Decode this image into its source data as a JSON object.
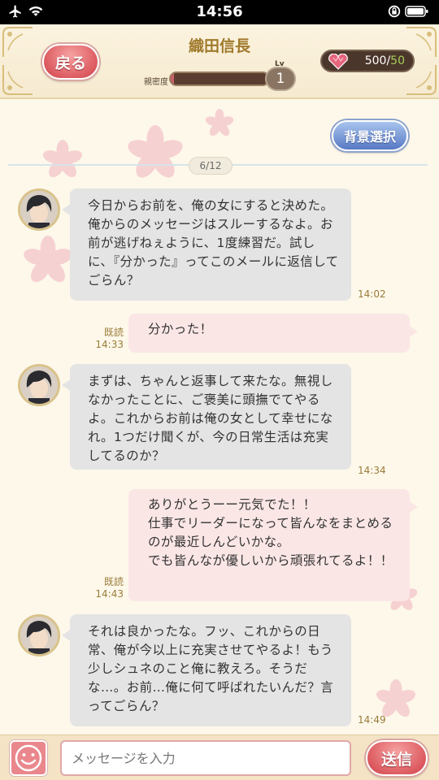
{
  "status_bar": {
    "time": "14:56"
  },
  "header": {
    "back_label": "戻る",
    "character_name": "織田信長",
    "intimacy_label": "親密度",
    "intimacy_progress": 0.03,
    "level_label": "Lv",
    "level": "1",
    "hearts_current": "500",
    "hearts_separator": "/",
    "hearts_max": "50"
  },
  "chat": {
    "background_button": "背景選択",
    "page_indicator": "6/12",
    "messages": [
      {
        "from": "character",
        "text": "今日からお前を、俺の女にすると決めた。俺からのメッセージはスルーするなよ。お前が逃げねぇように、1度練習だ。試しに、『分かった』ってこのメールに返信してごらん？",
        "time": "14:02"
      },
      {
        "from": "user",
        "text": "分かった！",
        "read": "既読",
        "time": "14:33"
      },
      {
        "from": "character",
        "text": "まずは、ちゃんと返事して来たな。無視しなかったことに、ご褒美に頭撫でてやるよ。これからお前は俺の女として幸せになれ。1つだけ聞くが、今の日常生活は充実してるのか？",
        "time": "14:34"
      },
      {
        "from": "user",
        "text": "ありがとうーー元気でた！！\n仕事でリーダーになって皆んなをまとめるのが最近しんどいかな。\nでも皆んなが優しいから頑張れてるよ！！",
        "read": "既読",
        "time": "14:43"
      },
      {
        "from": "character",
        "text": "それは良かったな。フッ、これからの日常、俺が今以上に充実させてやるよ！もう少しシュネのこと俺に教えろ。そうだな…。お前…俺に何て呼ばれたいんだ？言ってごらん？",
        "time": "14:49"
      }
    ]
  },
  "input_bar": {
    "placeholder": "メッセージを入力",
    "send_label": "送信"
  },
  "colors": {
    "accent": "#dd5c61",
    "header_title": "#a07a2c",
    "bubble_in": "#e4e4e4",
    "bubble_out": "#fbe6e6"
  }
}
